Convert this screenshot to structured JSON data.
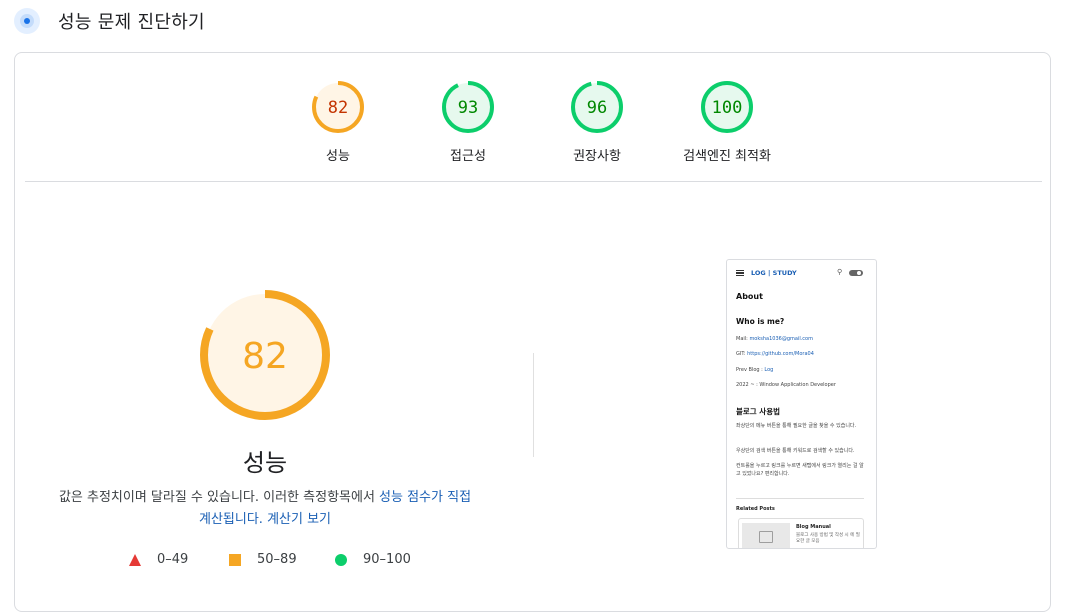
{
  "header": {
    "title": "성능 문제 진단하기",
    "icon": "lighthouse-icon"
  },
  "scores": [
    {
      "label": "성능",
      "value": "82",
      "color": "#f5a623",
      "bg": "#fff5e6",
      "text_color": "#c33300",
      "fraction": 0.82
    },
    {
      "label": "접근성",
      "value": "93",
      "color": "#0cce6b",
      "bg": "#e6f9ee",
      "text_color": "#008800",
      "fraction": 0.93
    },
    {
      "label": "권장사항",
      "value": "96",
      "color": "#0cce6b",
      "bg": "#e6f9ee",
      "text_color": "#008800",
      "fraction": 0.96
    },
    {
      "label": "검색엔진 최적화",
      "value": "100",
      "color": "#0cce6b",
      "bg": "#e6f9ee",
      "text_color": "#008800",
      "fraction": 1.0
    }
  ],
  "main": {
    "score": "82",
    "fraction": 0.82,
    "color": "#f5a623",
    "title": "성능",
    "description_prefix": "값은 추정치이며 달라질 수 있습니다. 이러한 측정항목에서 ",
    "link1": "성능 점수가 직접 계산됩니다.",
    "link2": "계산기 보기"
  },
  "legend": [
    {
      "shape": "triangle",
      "label": "0–49",
      "color": "#e53935"
    },
    {
      "shape": "square",
      "label": "50–89",
      "color": "#f5a623"
    },
    {
      "shape": "circle",
      "label": "90–100",
      "color": "#0cce6b"
    }
  ],
  "preview": {
    "logo": "LOG | STUDY",
    "page_title": "About",
    "who_heading": "Who is me?",
    "mail_label": "Mail: ",
    "mail_value": "moksha1036@gmail.com",
    "git_label": "GIT: ",
    "git_value": "https://github.com/Mora04",
    "prev_label": "Prev Blog : ",
    "prev_value": "Log",
    "job": "2022 ~ : Window Application Developer",
    "usage_heading": "블로그 사용법",
    "usage_1": "좌상단의 메뉴 버튼을 통해 필요한 글을 찾을 수 있습니다.",
    "usage_2": "우상단의 검색 버튼을 통해 키워드로 검색할 수 있습니다.",
    "usage_3": "컨트롤을 누르고 링크를 누르면 새탭에서 링크가 열리는 걸 알고 있었나요? 편리합니다.",
    "related": "Related Posts",
    "related_title": "Blog Manual",
    "related_text": "블로그 사용 방법 및 작성 시 에 필요한 글 모음"
  }
}
